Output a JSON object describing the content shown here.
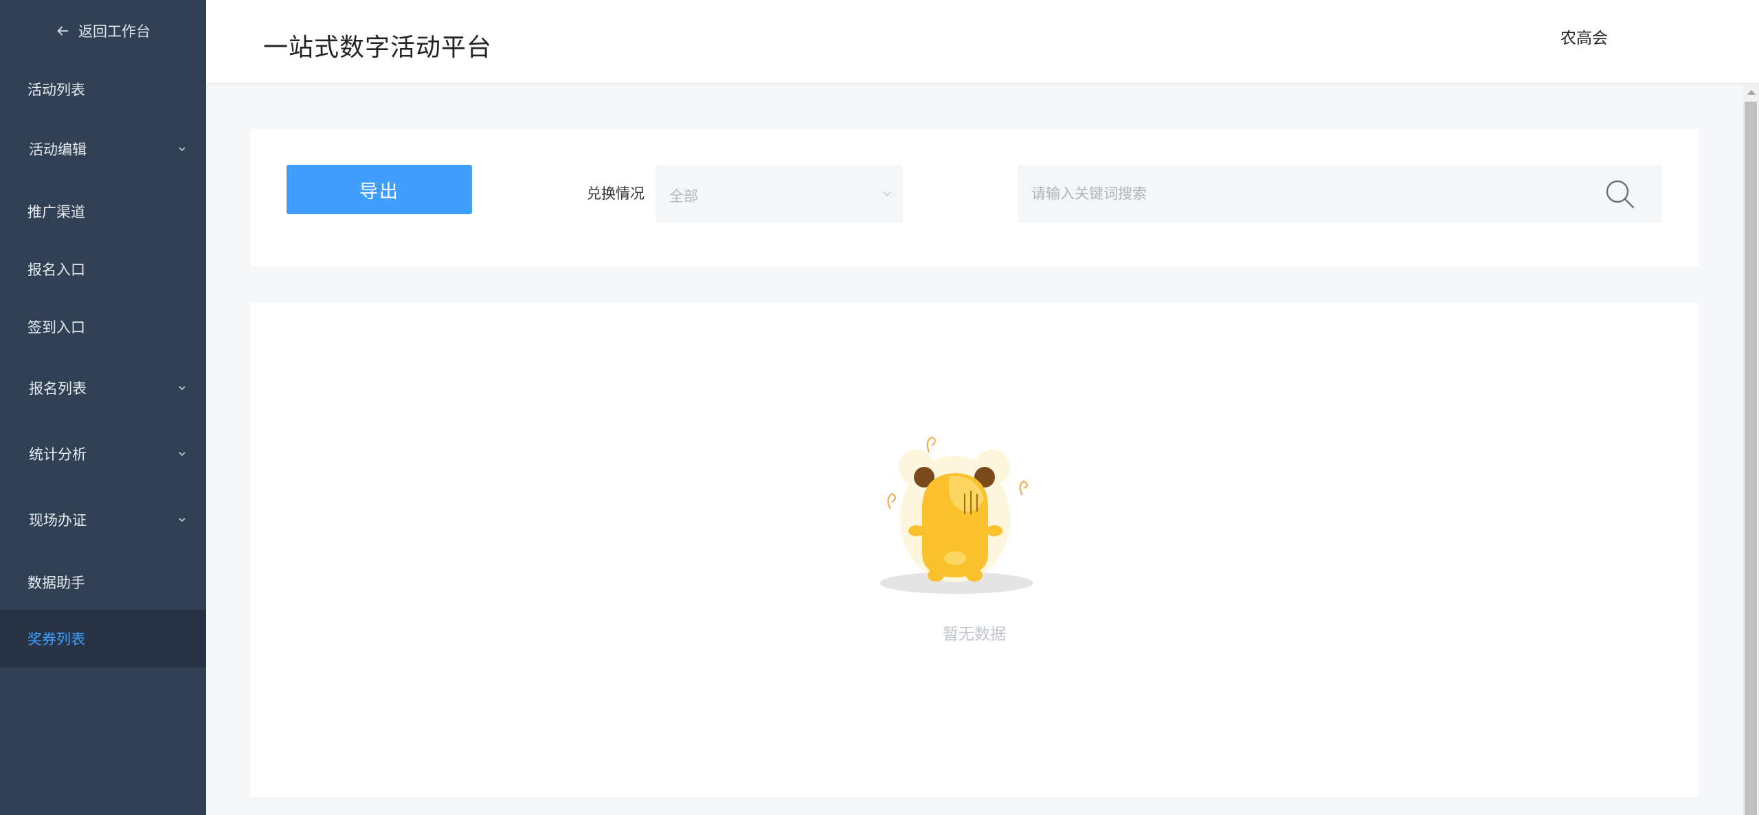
{
  "sidebar": {
    "back_label": "返回工作台",
    "items": [
      {
        "label": "活动列表",
        "has_sub": false,
        "active": false
      },
      {
        "label": "活动编辑",
        "has_sub": true,
        "active": false
      },
      {
        "label": "推广渠道",
        "has_sub": false,
        "active": false
      },
      {
        "label": "报名入口",
        "has_sub": false,
        "active": false
      },
      {
        "label": "签到入口",
        "has_sub": false,
        "active": false
      },
      {
        "label": "报名列表",
        "has_sub": true,
        "active": false
      },
      {
        "label": "统计分析",
        "has_sub": true,
        "active": false
      },
      {
        "label": "现场办证",
        "has_sub": true,
        "active": false
      },
      {
        "label": "数据助手",
        "has_sub": false,
        "active": false
      },
      {
        "label": "奖券列表",
        "has_sub": false,
        "active": true
      }
    ]
  },
  "header": {
    "title": "一站式数字活动平台",
    "user_name": "农高会"
  },
  "filter": {
    "export_label": "导出",
    "status_label": "兑换情况",
    "status_value": "全部",
    "search_placeholder": "请输入关键词搜索",
    "search_value": ""
  },
  "content": {
    "empty_text": "暂无数据"
  },
  "colors": {
    "sidebar_bg": "#304156",
    "sidebar_active_bg": "#263445",
    "accent": "#409eff",
    "empty_text": "#c0c4cc"
  }
}
